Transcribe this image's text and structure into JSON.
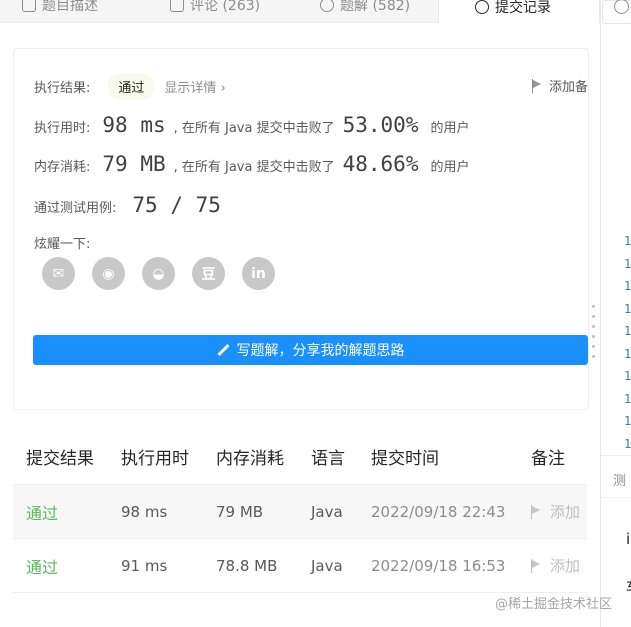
{
  "tabs": [
    {
      "label": "题目描述"
    },
    {
      "label": "评论 (263)"
    },
    {
      "label": "题解 (582)"
    },
    {
      "label": "提交记录"
    }
  ],
  "result": {
    "status_label": "执行结果:",
    "status_value": "通过",
    "detail_link": "显示详情 ›",
    "note_button": "添加备",
    "runtime_label": "执行用时:",
    "runtime_value": "98 ms",
    "runtime_mid": ", 在所有 Java 提交中击败了",
    "runtime_pct": "53.00%",
    "runtime_tail": "的用户",
    "memory_label": "内存消耗:",
    "memory_value": "79 MB",
    "memory_mid": ", 在所有 Java 提交中击败了",
    "memory_pct": "48.66%",
    "memory_tail": "的用户",
    "tests_label": "通过测试用例:",
    "tests_value": "75 / 75",
    "share_label": "炫耀一下:",
    "share_icons": [
      "wechat-icon",
      "weibo-icon",
      "qq-icon",
      "douban-icon",
      "linkedin-icon"
    ],
    "share_glyphs": [
      "✉",
      "◉",
      "◒",
      "豆",
      "in"
    ],
    "write_button": "写题解，分享我的解题思路"
  },
  "table": {
    "headers": [
      "提交结果",
      "执行用时",
      "内存消耗",
      "语言",
      "提交时间",
      "备注"
    ],
    "rows": [
      {
        "result": "通过",
        "time": "98 ms",
        "memory": "79 MB",
        "lang": "Java",
        "date": "2022/09/18 22:43",
        "note": "添加"
      },
      {
        "result": "通过",
        "time": "91 ms",
        "memory": "78.8 MB",
        "lang": "Java",
        "date": "2022/09/18 16:53",
        "note": "添加"
      }
    ]
  },
  "right_panel": {
    "line_numbers": [
      "1",
      "1",
      "1",
      "1",
      "1",
      "1",
      "1",
      "1",
      "1",
      "1"
    ],
    "label": "测",
    "char1": "i",
    "char2": "车"
  },
  "watermark": "@稀土掘金技术社区",
  "colors": {
    "accent_blue": "#1a90ff",
    "pass_green": "#5cb85c"
  }
}
